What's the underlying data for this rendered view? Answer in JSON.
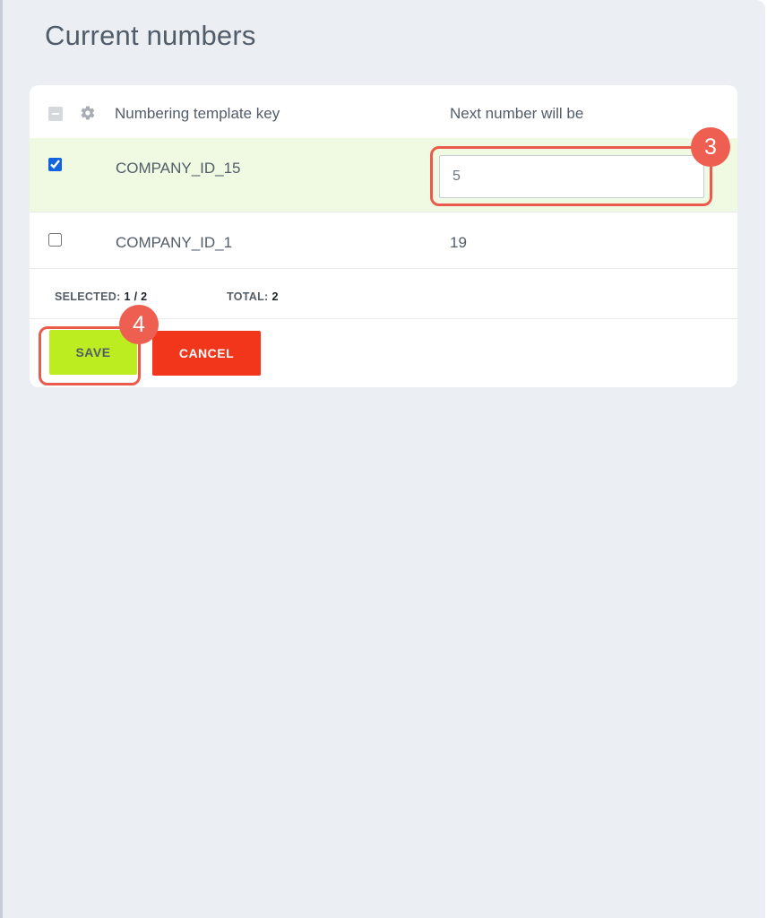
{
  "page": {
    "title": "Current numbers"
  },
  "table": {
    "columns": {
      "key": "Numbering template key",
      "next": "Next number will be"
    },
    "rows": [
      {
        "key": "COMPANY_ID_15",
        "next_number": "5",
        "selected": true,
        "editing": true
      },
      {
        "key": "COMPANY_ID_1",
        "next_number": "19",
        "selected": false,
        "editing": false
      }
    ],
    "footer": {
      "selected_label": "SELECTED:",
      "selected_value": "1 / 2",
      "total_label": "TOTAL:",
      "total_value": "2"
    }
  },
  "buttons": {
    "save": "SAVE",
    "cancel": "CANCEL"
  },
  "annotations": {
    "step_input": "3",
    "step_save": "4"
  },
  "icons": {
    "settings": "gear-icon",
    "select_all": "indeterminate-checkbox-icon"
  },
  "colors": {
    "save_button": "#bbed21",
    "cancel_button": "#f1361b",
    "selected_row": "#f0fae2",
    "annotation": "#ee5f51"
  }
}
